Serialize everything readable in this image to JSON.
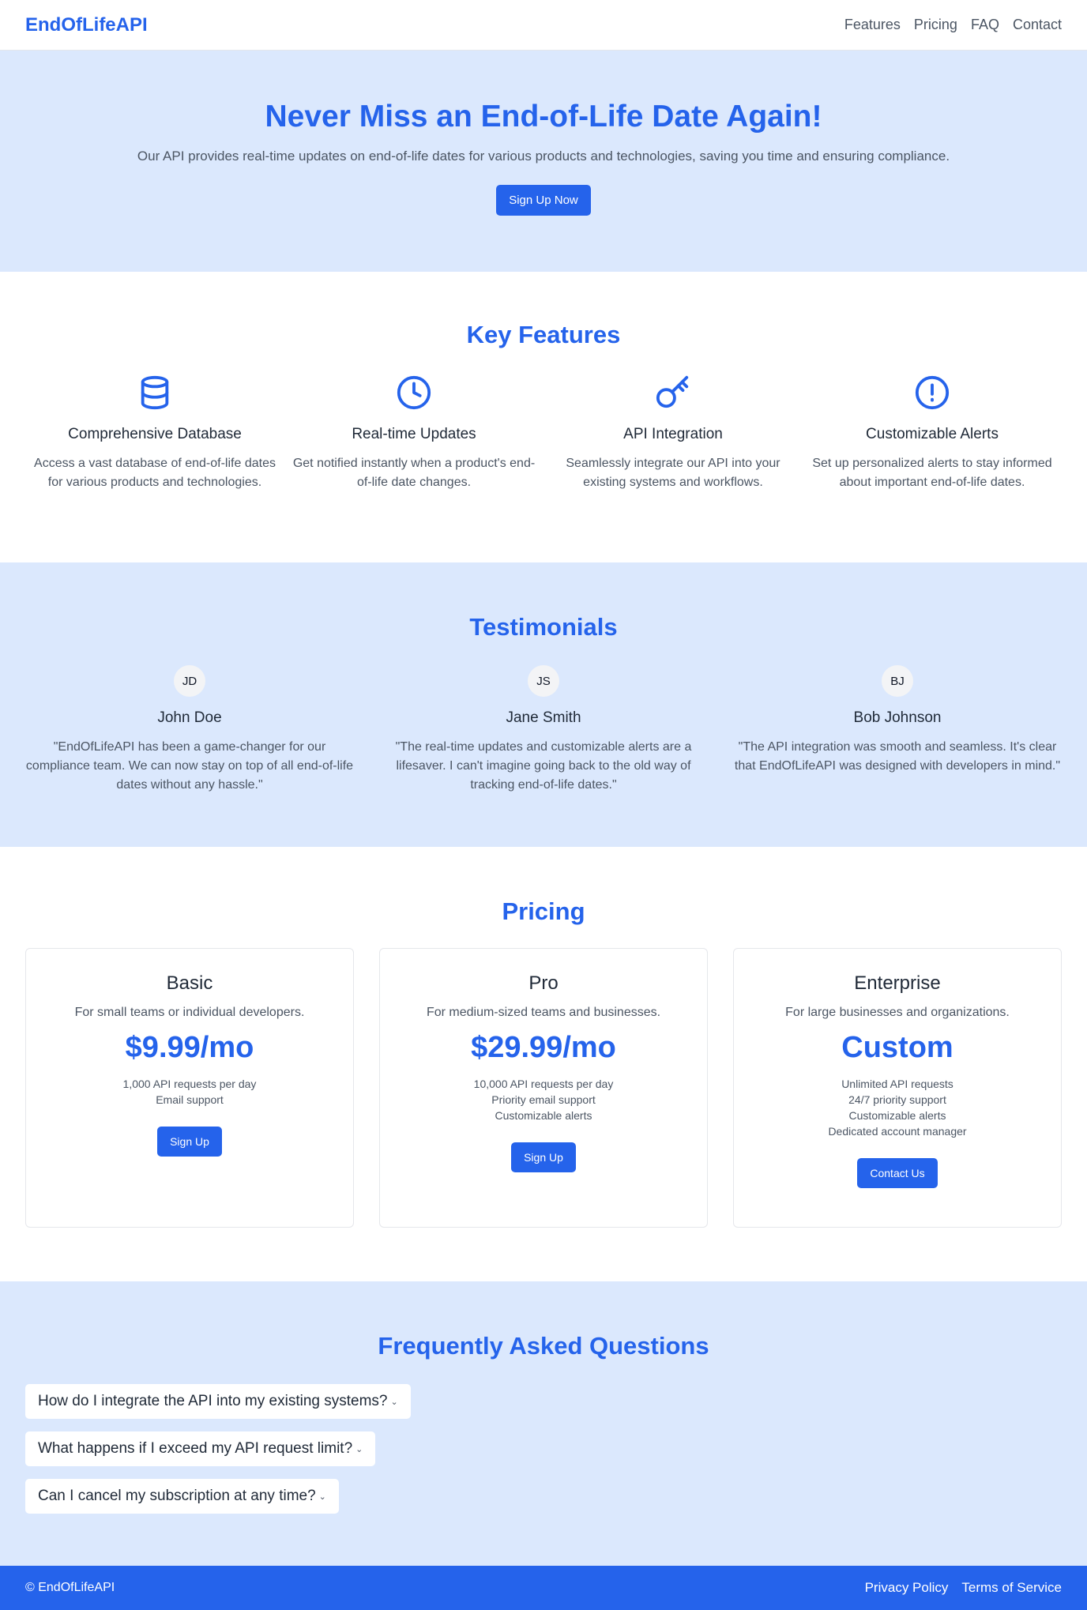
{
  "brand": {
    "name": "EndOfLifeAPI",
    "accent_color": "#2563eb",
    "light_bg": "#dbe8fd"
  },
  "nav": {
    "items": [
      "Features",
      "Pricing",
      "FAQ",
      "Contact"
    ]
  },
  "hero": {
    "title": "Never Miss an End-of-Life Date Again!",
    "subtitle": "Our API provides real-time updates on end-of-life dates for various products and technologies, saving you time and ensuring compliance.",
    "cta": "Sign Up Now"
  },
  "features": {
    "title": "Key Features",
    "items": [
      {
        "icon": "database-icon",
        "title": "Comprehensive Database",
        "text": "Access a vast database of end-of-life dates for various products and technologies."
      },
      {
        "icon": "clock-icon",
        "title": "Real-time Updates",
        "text": "Get notified instantly when a product's end-of-life date changes."
      },
      {
        "icon": "key-icon",
        "title": "API Integration",
        "text": "Seamlessly integrate our API into your existing systems and workflows."
      },
      {
        "icon": "alert-icon",
        "title": "Customizable Alerts",
        "text": "Set up personalized alerts to stay informed about important end-of-life dates."
      }
    ]
  },
  "testimonials": {
    "title": "Testimonials",
    "items": [
      {
        "initials": "JD",
        "name": "John Doe",
        "quote": "\"EndOfLifeAPI has been a game-changer for our compliance team. We can now stay on top of all end-of-life dates without any hassle.\""
      },
      {
        "initials": "JS",
        "name": "Jane Smith",
        "quote": "\"The real-time updates and customizable alerts are a lifesaver. I can't imagine going back to the old way of tracking end-of-life dates.\""
      },
      {
        "initials": "BJ",
        "name": "Bob Johnson",
        "quote": "\"The API integration was smooth and seamless. It's clear that EndOfLifeAPI was designed with developers in mind.\""
      }
    ]
  },
  "pricing": {
    "title": "Pricing",
    "plans": [
      {
        "name": "Basic",
        "desc": "For small teams or individual developers.",
        "price": "$9.99/mo",
        "features": [
          "1,000 API requests per day",
          "Email support"
        ],
        "cta": "Sign Up"
      },
      {
        "name": "Pro",
        "desc": "For medium-sized teams and businesses.",
        "price": "$29.99/mo",
        "features": [
          "10,000 API requests per day",
          "Priority email support",
          "Customizable alerts"
        ],
        "cta": "Sign Up"
      },
      {
        "name": "Enterprise",
        "desc": "For large businesses and organizations.",
        "price": "Custom",
        "features": [
          "Unlimited API requests",
          "24/7 priority support",
          "Customizable alerts",
          "Dedicated account manager"
        ],
        "cta": "Contact Us"
      }
    ]
  },
  "faq": {
    "title": "Frequently Asked Questions",
    "items": [
      "How do I integrate the API into my existing systems?",
      "What happens if I exceed my API request limit?",
      "Can I cancel my subscription at any time?"
    ]
  },
  "footer": {
    "copyright": "© EndOfLifeAPI",
    "links": [
      "Privacy Policy",
      "Terms of Service"
    ]
  }
}
